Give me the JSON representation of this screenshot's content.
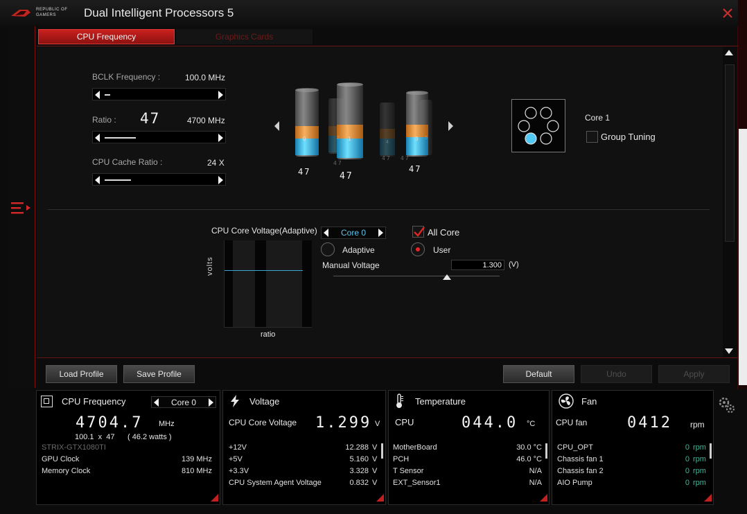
{
  "window": {
    "brand_line1": "REPUBLIC OF",
    "brand_line2": "GAMERS",
    "title": "Dual Intelligent Processors 5"
  },
  "tabs": [
    {
      "label": "CPU Frequency",
      "active": true
    },
    {
      "label": "Graphics Cards",
      "active": false
    }
  ],
  "cpu_frequency": {
    "bclk_label": "BCLK Frequency :",
    "bclk_value": "100.0",
    "bclk_unit": "MHz",
    "bclk_slider_fraction": 0.05,
    "ratio_label": "Ratio :",
    "ratio_value": "47",
    "ratio_mhz": "4700",
    "ratio_unit": "MHz",
    "ratio_slider_fraction": 0.28,
    "cache_label": "CPU Cache Ratio :",
    "cache_value": "24",
    "cache_unit": "X",
    "cache_slider_fraction": 0.24
  },
  "core_bars": [
    {
      "label": "47",
      "index": "0"
    },
    {
      "label": "47",
      "index": "1"
    },
    {
      "label": "47",
      "index": "2"
    },
    {
      "label": "47",
      "index": "3"
    },
    {
      "label": "47",
      "index": "4"
    },
    {
      "label": "47",
      "index": "5"
    }
  ],
  "core_map": {
    "selected_core": "Core 1",
    "group_tuning_label": "Group Tuning",
    "group_tuning_checked": false
  },
  "voltage": {
    "chart_title": "CPU Core Voltage(Adaptive)",
    "ylabel": "volts",
    "xlabel": "ratio",
    "core_select": "Core 0",
    "all_core_label": "All Core",
    "all_core_checked": true,
    "mode_adaptive": "Adaptive",
    "mode_user": "User",
    "mode_selected": "User",
    "manual_label": "Manual Voltage",
    "manual_value": "1.300",
    "manual_unit": "(V)"
  },
  "buttons": {
    "load_profile": "Load Profile",
    "save_profile": "Save Profile",
    "default": "Default",
    "undo": "Undo",
    "apply": "Apply"
  },
  "panel_cpu": {
    "title": "CPU Frequency",
    "core_select": "Core 0",
    "freq_value": "4704.7",
    "freq_unit": "MHz",
    "bclk_ratio": "100.1  x  47",
    "watts": "( 46.2 watts )",
    "gpu_name": "STRIX-GTX1080TI",
    "rows": [
      {
        "label": "GPU Clock",
        "value": "139 MHz"
      },
      {
        "label": "Memory Clock",
        "value": "810 MHz"
      }
    ]
  },
  "panel_voltage": {
    "title": "Voltage",
    "main_label": "CPU Core Voltage",
    "main_value": "1.299",
    "main_unit": "V",
    "rows": [
      {
        "label": "+12V",
        "value": "12.288",
        "unit": "V"
      },
      {
        "label": "+5V",
        "value": "5.160",
        "unit": "V"
      },
      {
        "label": "+3.3V",
        "value": "3.328",
        "unit": "V"
      },
      {
        "label": "CPU System Agent Voltage",
        "value": "0.832",
        "unit": "V"
      }
    ]
  },
  "panel_temp": {
    "title": "Temperature",
    "main_label": "CPU",
    "main_value": "044.0",
    "main_unit": "°C",
    "rows": [
      {
        "label": "MotherBoard",
        "value": "30.0 °C"
      },
      {
        "label": "PCH",
        "value": "46.0 °C"
      },
      {
        "label": "T Sensor",
        "value": "N/A"
      },
      {
        "label": "EXT_Sensor1",
        "value": "N/A"
      }
    ]
  },
  "panel_fan": {
    "title": "Fan",
    "main_label": "CPU fan",
    "main_value": "0412",
    "main_unit": "rpm",
    "rows": [
      {
        "label": "CPU_OPT",
        "value": "0",
        "unit": "rpm"
      },
      {
        "label": "Chassis fan 1",
        "value": "0",
        "unit": "rpm"
      },
      {
        "label": "Chassis fan 2",
        "value": "0",
        "unit": "rpm"
      },
      {
        "label": "AIO Pump",
        "value": "0",
        "unit": "rpm"
      }
    ]
  },
  "colors": {
    "accent_red": "#c8201e",
    "liquid_orange": "#e8902a",
    "liquid_blue": "#2fb8e6",
    "rpm_green": "#3fb69a"
  }
}
